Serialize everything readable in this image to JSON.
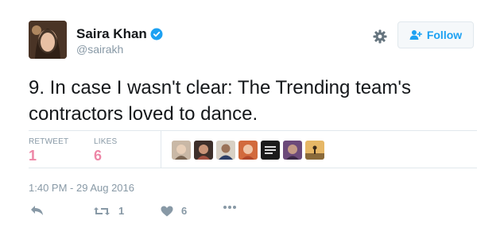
{
  "profile": {
    "name": "Saira Khan",
    "handle": "@sairakh",
    "verified_color": "#1da1f2"
  },
  "header": {
    "follow_label": "Follow",
    "icons": [
      "gear-icon",
      "follow-person-icon"
    ]
  },
  "tweet": {
    "text": "9. In case I wasn't clear: The Trending team's contractors loved to dance.",
    "timestamp": "1:40 PM - 29 Aug 2016"
  },
  "stats": {
    "retweet_label": "RETWEET",
    "retweet_count": "1",
    "likes_label": "LIKES",
    "likes_count": "6",
    "liker_avatar_count": 7
  },
  "actions": {
    "reply_icon": "reply-icon",
    "retweet_count": "1",
    "like_count": "6",
    "more_icon": "more-icon"
  },
  "colors": {
    "accent": "#1da1f2",
    "like_red": "#e0245e",
    "muted": "#8899a6",
    "text": "#14171a"
  }
}
